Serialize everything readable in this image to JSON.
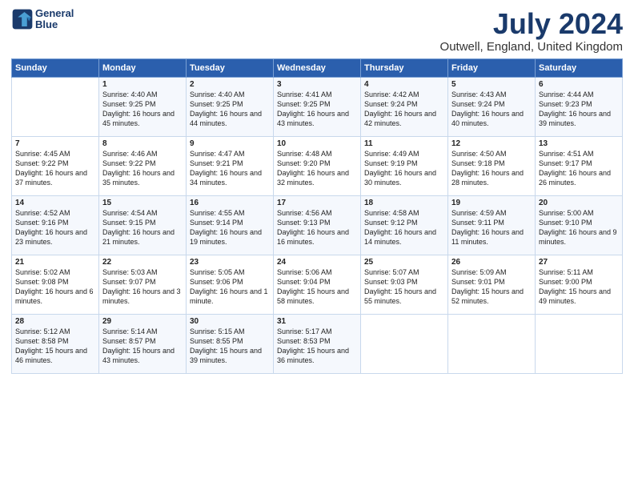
{
  "logo": {
    "line1": "General",
    "line2": "Blue"
  },
  "title": "July 2024",
  "subtitle": "Outwell, England, United Kingdom",
  "days_of_week": [
    "Sunday",
    "Monday",
    "Tuesday",
    "Wednesday",
    "Thursday",
    "Friday",
    "Saturday"
  ],
  "weeks": [
    [
      {
        "day": "",
        "sunrise": "",
        "sunset": "",
        "daylight": ""
      },
      {
        "day": "1",
        "sunrise": "Sunrise: 4:40 AM",
        "sunset": "Sunset: 9:25 PM",
        "daylight": "Daylight: 16 hours and 45 minutes."
      },
      {
        "day": "2",
        "sunrise": "Sunrise: 4:40 AM",
        "sunset": "Sunset: 9:25 PM",
        "daylight": "Daylight: 16 hours and 44 minutes."
      },
      {
        "day": "3",
        "sunrise": "Sunrise: 4:41 AM",
        "sunset": "Sunset: 9:25 PM",
        "daylight": "Daylight: 16 hours and 43 minutes."
      },
      {
        "day": "4",
        "sunrise": "Sunrise: 4:42 AM",
        "sunset": "Sunset: 9:24 PM",
        "daylight": "Daylight: 16 hours and 42 minutes."
      },
      {
        "day": "5",
        "sunrise": "Sunrise: 4:43 AM",
        "sunset": "Sunset: 9:24 PM",
        "daylight": "Daylight: 16 hours and 40 minutes."
      },
      {
        "day": "6",
        "sunrise": "Sunrise: 4:44 AM",
        "sunset": "Sunset: 9:23 PM",
        "daylight": "Daylight: 16 hours and 39 minutes."
      }
    ],
    [
      {
        "day": "7",
        "sunrise": "Sunrise: 4:45 AM",
        "sunset": "Sunset: 9:22 PM",
        "daylight": "Daylight: 16 hours and 37 minutes."
      },
      {
        "day": "8",
        "sunrise": "Sunrise: 4:46 AM",
        "sunset": "Sunset: 9:22 PM",
        "daylight": "Daylight: 16 hours and 35 minutes."
      },
      {
        "day": "9",
        "sunrise": "Sunrise: 4:47 AM",
        "sunset": "Sunset: 9:21 PM",
        "daylight": "Daylight: 16 hours and 34 minutes."
      },
      {
        "day": "10",
        "sunrise": "Sunrise: 4:48 AM",
        "sunset": "Sunset: 9:20 PM",
        "daylight": "Daylight: 16 hours and 32 minutes."
      },
      {
        "day": "11",
        "sunrise": "Sunrise: 4:49 AM",
        "sunset": "Sunset: 9:19 PM",
        "daylight": "Daylight: 16 hours and 30 minutes."
      },
      {
        "day": "12",
        "sunrise": "Sunrise: 4:50 AM",
        "sunset": "Sunset: 9:18 PM",
        "daylight": "Daylight: 16 hours and 28 minutes."
      },
      {
        "day": "13",
        "sunrise": "Sunrise: 4:51 AM",
        "sunset": "Sunset: 9:17 PM",
        "daylight": "Daylight: 16 hours and 26 minutes."
      }
    ],
    [
      {
        "day": "14",
        "sunrise": "Sunrise: 4:52 AM",
        "sunset": "Sunset: 9:16 PM",
        "daylight": "Daylight: 16 hours and 23 minutes."
      },
      {
        "day": "15",
        "sunrise": "Sunrise: 4:54 AM",
        "sunset": "Sunset: 9:15 PM",
        "daylight": "Daylight: 16 hours and 21 minutes."
      },
      {
        "day": "16",
        "sunrise": "Sunrise: 4:55 AM",
        "sunset": "Sunset: 9:14 PM",
        "daylight": "Daylight: 16 hours and 19 minutes."
      },
      {
        "day": "17",
        "sunrise": "Sunrise: 4:56 AM",
        "sunset": "Sunset: 9:13 PM",
        "daylight": "Daylight: 16 hours and 16 minutes."
      },
      {
        "day": "18",
        "sunrise": "Sunrise: 4:58 AM",
        "sunset": "Sunset: 9:12 PM",
        "daylight": "Daylight: 16 hours and 14 minutes."
      },
      {
        "day": "19",
        "sunrise": "Sunrise: 4:59 AM",
        "sunset": "Sunset: 9:11 PM",
        "daylight": "Daylight: 16 hours and 11 minutes."
      },
      {
        "day": "20",
        "sunrise": "Sunrise: 5:00 AM",
        "sunset": "Sunset: 9:10 PM",
        "daylight": "Daylight: 16 hours and 9 minutes."
      }
    ],
    [
      {
        "day": "21",
        "sunrise": "Sunrise: 5:02 AM",
        "sunset": "Sunset: 9:08 PM",
        "daylight": "Daylight: 16 hours and 6 minutes."
      },
      {
        "day": "22",
        "sunrise": "Sunrise: 5:03 AM",
        "sunset": "Sunset: 9:07 PM",
        "daylight": "Daylight: 16 hours and 3 minutes."
      },
      {
        "day": "23",
        "sunrise": "Sunrise: 5:05 AM",
        "sunset": "Sunset: 9:06 PM",
        "daylight": "Daylight: 16 hours and 1 minute."
      },
      {
        "day": "24",
        "sunrise": "Sunrise: 5:06 AM",
        "sunset": "Sunset: 9:04 PM",
        "daylight": "Daylight: 15 hours and 58 minutes."
      },
      {
        "day": "25",
        "sunrise": "Sunrise: 5:07 AM",
        "sunset": "Sunset: 9:03 PM",
        "daylight": "Daylight: 15 hours and 55 minutes."
      },
      {
        "day": "26",
        "sunrise": "Sunrise: 5:09 AM",
        "sunset": "Sunset: 9:01 PM",
        "daylight": "Daylight: 15 hours and 52 minutes."
      },
      {
        "day": "27",
        "sunrise": "Sunrise: 5:11 AM",
        "sunset": "Sunset: 9:00 PM",
        "daylight": "Daylight: 15 hours and 49 minutes."
      }
    ],
    [
      {
        "day": "28",
        "sunrise": "Sunrise: 5:12 AM",
        "sunset": "Sunset: 8:58 PM",
        "daylight": "Daylight: 15 hours and 46 minutes."
      },
      {
        "day": "29",
        "sunrise": "Sunrise: 5:14 AM",
        "sunset": "Sunset: 8:57 PM",
        "daylight": "Daylight: 15 hours and 43 minutes."
      },
      {
        "day": "30",
        "sunrise": "Sunrise: 5:15 AM",
        "sunset": "Sunset: 8:55 PM",
        "daylight": "Daylight: 15 hours and 39 minutes."
      },
      {
        "day": "31",
        "sunrise": "Sunrise: 5:17 AM",
        "sunset": "Sunset: 8:53 PM",
        "daylight": "Daylight: 15 hours and 36 minutes."
      },
      {
        "day": "",
        "sunrise": "",
        "sunset": "",
        "daylight": ""
      },
      {
        "day": "",
        "sunrise": "",
        "sunset": "",
        "daylight": ""
      },
      {
        "day": "",
        "sunrise": "",
        "sunset": "",
        "daylight": ""
      }
    ]
  ],
  "accent_color": "#2b5fad"
}
